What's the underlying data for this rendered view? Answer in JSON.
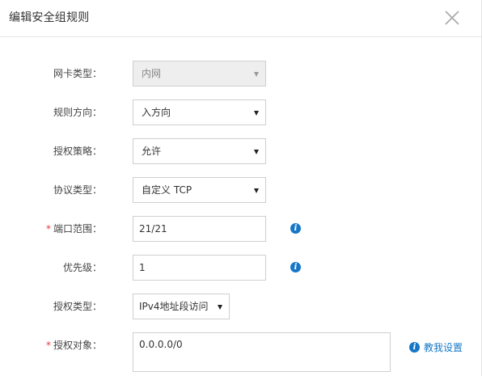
{
  "dialog": {
    "title": "编辑安全组规则"
  },
  "form": {
    "nic_type": {
      "label": "网卡类型：",
      "value": "内网",
      "disabled": true
    },
    "rule_direction": {
      "label": "规则方向：",
      "value": "入方向"
    },
    "auth_policy": {
      "label": "授权策略：",
      "value": "允许"
    },
    "protocol_type": {
      "label": "协议类型：",
      "value": "自定义 TCP"
    },
    "port_range": {
      "required_mark": "*",
      "label": "端口范围：",
      "value": "21/21"
    },
    "priority": {
      "label": "优先级：",
      "value": "1"
    },
    "auth_type": {
      "label": "授权类型：",
      "value": "IPv4地址段访问"
    },
    "auth_object": {
      "required_mark": "*",
      "label": "授权对象：",
      "value": "0.0.0.0/0",
      "help_link": "教我设置"
    }
  },
  "icons": {
    "info": "info-icon",
    "close": "close-icon",
    "dropdown": "chevron-down-icon"
  },
  "colors": {
    "accent": "#1677c8",
    "required": "#e4393c",
    "disabled_bg": "#eeeeee"
  }
}
